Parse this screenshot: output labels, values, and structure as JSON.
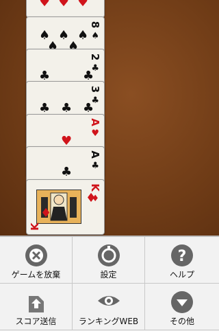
{
  "cards": [
    {
      "rank": "",
      "suit": "♥",
      "color": "red"
    },
    {
      "rank": "8",
      "suit": "♠",
      "color": "black"
    },
    {
      "rank": "2",
      "suit": "♣",
      "color": "black"
    },
    {
      "rank": "3",
      "suit": "♣",
      "color": "black"
    },
    {
      "rank": "A",
      "suit": "♥",
      "color": "red"
    },
    {
      "rank": "A",
      "suit": "♣",
      "color": "black"
    },
    {
      "rank": "K",
      "suit": "♦",
      "color": "red"
    }
  ],
  "menu": {
    "items": [
      {
        "label": "ゲームを放棄",
        "icon": "close-circle-icon"
      },
      {
        "label": "設定",
        "icon": "settings-icon"
      },
      {
        "label": "ヘルプ",
        "icon": "help-icon"
      },
      {
        "label": "スコア送信",
        "icon": "upload-icon"
      },
      {
        "label": "ランキングWEB",
        "icon": "eye-icon"
      },
      {
        "label": "その他",
        "icon": "chevron-down-circle-icon"
      }
    ]
  }
}
